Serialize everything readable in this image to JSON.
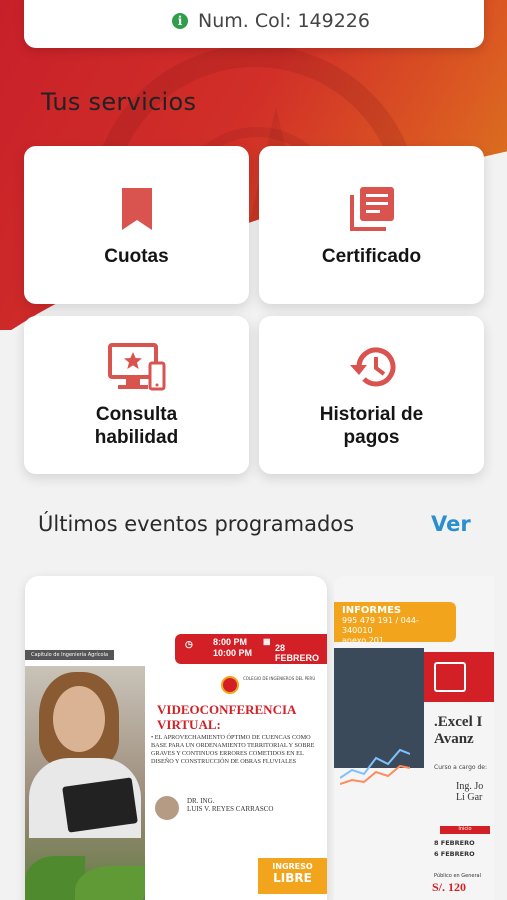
{
  "profile": {
    "col_number": "Num. Col: 149226"
  },
  "services": {
    "title": "Tus servicios",
    "items": [
      {
        "label": "Cuotas",
        "icon": "bookmark-icon"
      },
      {
        "label": "Certificado",
        "icon": "document-stack-icon"
      },
      {
        "label": "Consulta habilidad",
        "icon": "monitor-phone-star-icon"
      },
      {
        "label": "Historial de pagos",
        "icon": "history-clock-icon"
      }
    ]
  },
  "events": {
    "title": "Últimos eventos programados",
    "see_all": "Ver",
    "flyer1": {
      "category": "Capítulo de Ingeniería Agrícola",
      "time1": "8:00 PM",
      "time2": "10:00 PM",
      "date": "28 FEBRERO",
      "org": "COLEGIO DE INGENIEROS DEL PERÚ",
      "heading1": "VIDEOCONFERENCIA",
      "heading2": "VIRTUAL:",
      "topic": "• EL APROVECHAMIENTO ÓPTIMO DE CUENCAS COMO BASE PARA UN ORDENAMIENTO TERRITORIAL Y SOBRE GRAVES Y CONTINUOS ERRORES COMETIDOS EN EL DISEÑO Y CONSTRUCCIÓN DE OBRAS FLUVIALES",
      "speaker1": "DR. ING.",
      "speaker2": "LUIS V. REYES CARRASCO",
      "free1": "INGRESO",
      "free2": "LIBRE"
    },
    "flyer2": {
      "informes": "INFORMES",
      "phones": "995 479 191 / 044-340010",
      "annex": "anexo 201",
      "title1": ".Excel I",
      "title2": "Avanz",
      "course_by": "Curso a cargo de:",
      "instructor1": "Ing. Jo",
      "instructor2": "Li Gar",
      "start_label": "Inicio",
      "date1": "8 FEBRERO",
      "date2": "6 FEBRERO",
      "price_label": "Público en General",
      "price": "S/. 120"
    }
  },
  "colors": {
    "accent_red": "#d9534f",
    "link_blue": "#2a8fcf",
    "status_green": "#2e9e4a"
  }
}
